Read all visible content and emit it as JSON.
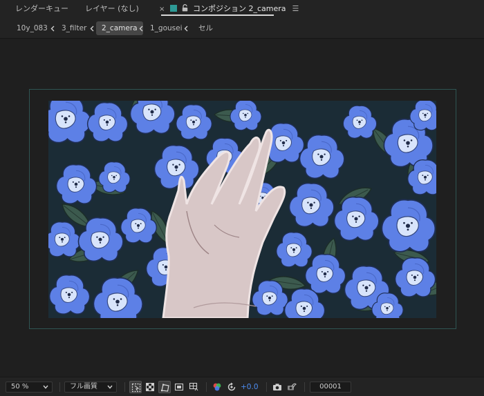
{
  "tabs": {
    "render_queue": "レンダーキュー",
    "layer": "レイヤー (なし)",
    "composition": "コンポジション 2_camera",
    "close_glyph": "×",
    "menu_glyph": "☰",
    "comp_color": "#2e9a95"
  },
  "breadcrumbs": [
    {
      "label": "10y_083",
      "active": false
    },
    {
      "label": "3_filter",
      "active": false
    },
    {
      "label": "2_camera",
      "active": true
    },
    {
      "label": "1_gousei",
      "active": false
    },
    {
      "label": "セル",
      "active": false
    }
  ],
  "viewer": {
    "frame_color": "#2f5553",
    "background": "#1f1f1f"
  },
  "toolbar": {
    "zoom": "50 %",
    "resolution": "フル画質",
    "exposure": "+0.0",
    "exposure_color": "#4d8df2",
    "current_frame": "00001",
    "icons": [
      "region-of-interest-icon",
      "transparency-grid-icon",
      "mask-path-visibility-icon",
      "safe-margins-icon",
      "grid-guides-icon",
      "color-channels-icon",
      "reset-exposure-icon",
      "snapshot-camera-icon",
      "show-snapshot-icon"
    ]
  }
}
